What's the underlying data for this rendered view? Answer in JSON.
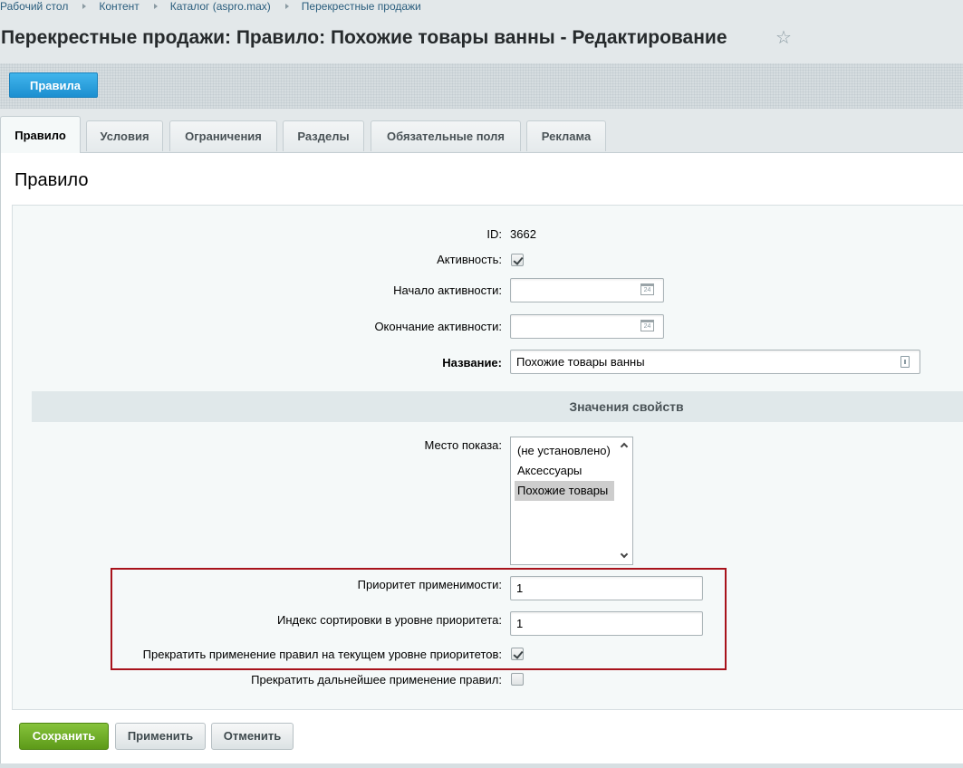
{
  "breadcrumbs": [
    "Рабочий стол",
    "Контент",
    "Каталог (aspro.max)",
    "Перекрестные продажи"
  ],
  "page_title": "Перекрестные продажи: Правило: Похожие товары ванны - Редактирование",
  "toolbar": {
    "back_label": "Правила"
  },
  "tabs": [
    "Правило",
    "Условия",
    "Ограничения",
    "Разделы",
    "Обязательные поля",
    "Реклама"
  ],
  "active_tab": "Правило",
  "panel_title": "Правило",
  "form": {
    "id_label": "ID:",
    "id_value": "3662",
    "active_label": "Активность:",
    "active_checked": true,
    "start_label": "Начало активности:",
    "start_value": "",
    "end_label": "Окончание активности:",
    "end_value": "",
    "name_label": "Название:",
    "name_value": "Похожие товары ванны",
    "section_header": "Значения свойств",
    "place_label": "Место показа:",
    "place_options": [
      "(не установлено)",
      "Аксессуары",
      "Похожие товары"
    ],
    "place_selected": "Похожие товары",
    "priority_label": "Приоритет применимости:",
    "priority_value": "1",
    "sort_label": "Индекс сортировки в уровне приоритета:",
    "sort_value": "1",
    "stop_level_label": "Прекратить применение правил на текущем уровне приоритетов:",
    "stop_level_checked": true,
    "stop_all_label": "Прекратить дальнейшее применение правил:",
    "stop_all_checked": false
  },
  "footer": {
    "save": "Сохранить",
    "apply": "Применить",
    "cancel": "Отменить"
  },
  "colors": {
    "save_green": "#6aa826",
    "back_blue": "#2a9fde",
    "highlight_red": "#a8131c"
  }
}
